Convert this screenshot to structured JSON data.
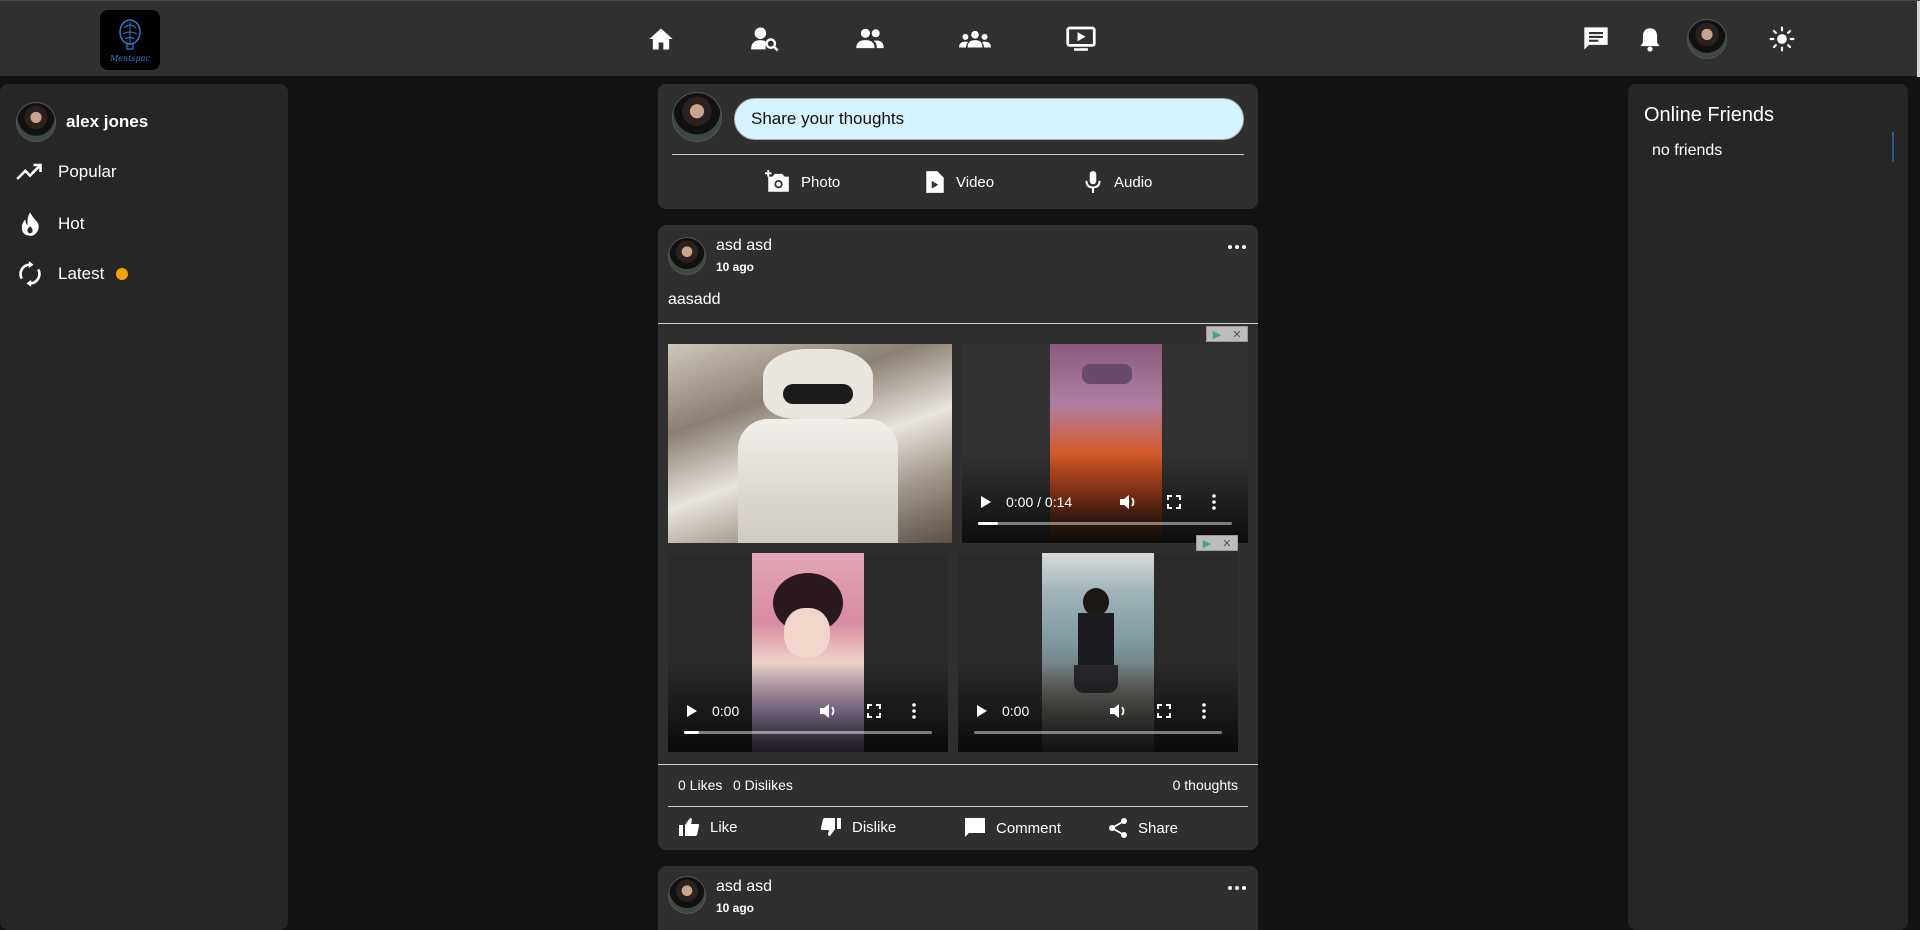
{
  "app": {
    "logo_text": "Mentspac"
  },
  "nav": {
    "items": [
      "home-icon",
      "find-friends-icon",
      "friends-icon",
      "groups-icon",
      "watch-icon"
    ]
  },
  "header_right": {
    "items": [
      "messages-icon",
      "notifications-icon",
      "avatar",
      "theme-toggle-icon"
    ]
  },
  "sidebar": {
    "user_name": "alex jones",
    "items": [
      {
        "label": "Popular",
        "icon": "trending-up-icon"
      },
      {
        "label": "Hot",
        "icon": "flame-icon"
      },
      {
        "label": "Latest",
        "icon": "refresh-icon",
        "badge_color": "#f5a300"
      }
    ]
  },
  "composer": {
    "placeholder": "Share your thoughts",
    "actions": [
      {
        "label": "Photo",
        "icon": "add-photo-icon"
      },
      {
        "label": "Video",
        "icon": "video-file-icon"
      },
      {
        "label": "Audio",
        "icon": "microphone-icon"
      }
    ]
  },
  "posts": [
    {
      "author": "asd asd",
      "time": "10 ago",
      "text": "aasadd",
      "media": [
        {
          "type": "image"
        },
        {
          "type": "video",
          "time": "0:00 / 0:14",
          "progress": 0.08
        },
        {
          "type": "video",
          "time": "0:00",
          "progress": 0.06
        },
        {
          "type": "video",
          "time": "0:00",
          "progress": 0
        }
      ],
      "likes": "0 Likes",
      "dislikes": "0 Dislikes",
      "thoughts": "0 thoughts",
      "actions": [
        "Like",
        "Dislike",
        "Comment",
        "Share"
      ]
    },
    {
      "author": "asd asd",
      "time": "10 ago"
    }
  ],
  "online_friends": {
    "title": "Online Friends",
    "empty": "no friends"
  },
  "colors": {
    "accent_input": "#d6f4ff",
    "badge": "#f5a300",
    "background": "#121212",
    "card": "#2f2f2f"
  }
}
